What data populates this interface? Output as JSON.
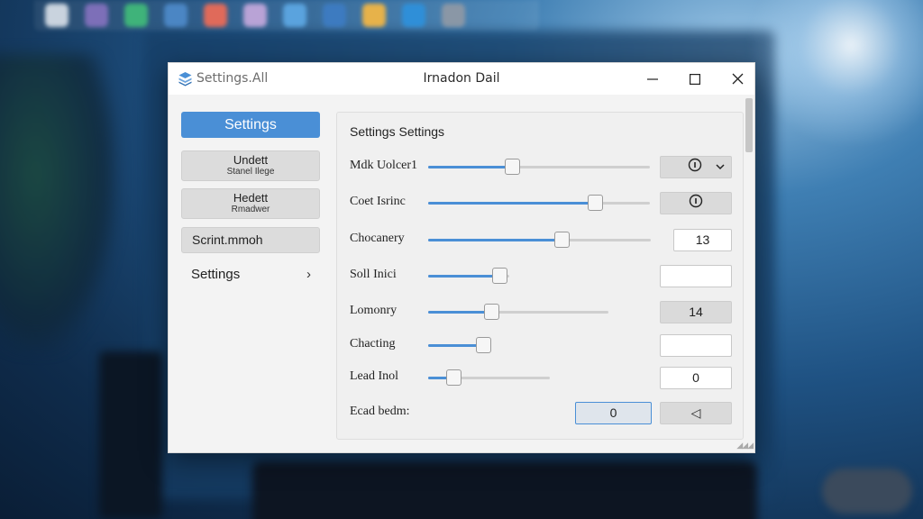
{
  "window": {
    "app_label": "Settings.All",
    "title": "Irnadon Dail",
    "minimize_label": "–",
    "maximize_label": "☐",
    "close_label": "✕"
  },
  "sidebar": {
    "active": "Settings",
    "cards": [
      {
        "line1": "Undett",
        "line2": "Stanel Ilege"
      },
      {
        "line1": "Hedett",
        "line2": "Rmadwer"
      }
    ],
    "flat_item": "Scrint.mmoh",
    "link_item": "Settings",
    "link_chevron": "›"
  },
  "panel": {
    "title": "Settings Settings",
    "rows": [
      {
        "label": "Mdk Uolcer1",
        "value": 0.38,
        "control": "Ⓘ",
        "control_type": "dropdown"
      },
      {
        "label": "Coet Isrinc",
        "value": 0.75,
        "control": "Ⓘ",
        "control_type": "button"
      },
      {
        "label": "Chocanery",
        "value": 0.6,
        "control": "13",
        "control_type": "input"
      },
      {
        "label": "Soll Inici",
        "value": 0.88,
        "control": "",
        "control_type": "input"
      },
      {
        "label": "Lomonry",
        "value": 0.35,
        "control": "14",
        "control_type": "button"
      },
      {
        "label": "Chacting",
        "value": 0.87,
        "control": "",
        "control_type": "input"
      },
      {
        "label": "Lead Inol",
        "value": 0.21,
        "control": "0",
        "control_type": "input"
      }
    ],
    "last_row": {
      "label": "Ecad bedm:",
      "input_value": "0",
      "button_icon": "◁"
    }
  },
  "icons": {
    "app": "settings-app-icon",
    "info": "info-icon",
    "caret": "chevron-down-icon",
    "back": "back-arrow-icon"
  },
  "colors": {
    "accent": "#4a8fd6"
  }
}
